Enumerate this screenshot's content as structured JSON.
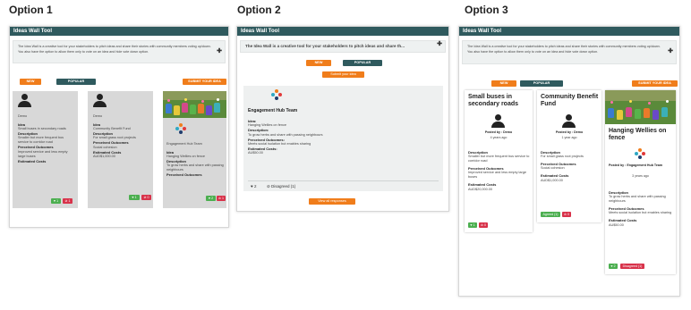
{
  "options": [
    "Option 1",
    "Option 2",
    "Option 3"
  ],
  "header_title": "Ideas Wall Tool",
  "description": "The Idea Wall is a creative tool for your stakeholders to pitch ideas and share their stories with community members voting up/down. You also have the option to allow them only to vote on an idea and hide vote down option.",
  "opt2_description": "The Idea Wall is a creative tool for your stakeholders to pitch ideas and share th...",
  "buttons": {
    "new": "NEW",
    "popular": "POPULAR",
    "submit_upper": "SUBMIT YOUR IDEA",
    "submit": "Submit your idea",
    "view_all": "View all responses"
  },
  "labels": {
    "idea": "Idea",
    "description": "Description",
    "perceived": "Perceived Outcomes",
    "estimated": "Estimated Costs"
  },
  "opt1_cards": [
    {
      "author": "Demo",
      "idea": "Small buses in secondary roads",
      "description": "Smaller but more frequent bus service to corridor road",
      "perceived": "Improved service and less empty large buses",
      "likes": "1",
      "dislikes": "1"
    },
    {
      "author": "Demo",
      "idea": "Community Benefit Fund",
      "description": "For small grass root projects",
      "perceived": "Social cohesion",
      "estimated": "AUD$1,000.00",
      "likes": "1",
      "dislikes": "0"
    },
    {
      "author": "Engagement Hub Team",
      "idea": "Hanging Wellies on fence",
      "description": "To grow herbs and share with passing neighbours",
      "perceived": "",
      "likes": "2",
      "dislikes": "1"
    }
  ],
  "opt2_card": {
    "author": "Engagement Hub Team",
    "idea_label": "Idea:",
    "idea": "Hanging Wellies on fence",
    "description_label": "Description:",
    "description": "To grow herbs and share with passing neighbours",
    "perceived_label": "Perceived Outcomes:",
    "perceived": "Meets social isolation but enables sharing",
    "estimated_label": "Estimated Costs:",
    "estimated": "AU$50.00",
    "likes": "2",
    "disagreed": "Disagreed (1)"
  },
  "opt3_cards": [
    {
      "title": "Small buses in secondary roads",
      "posted_by": "Posted by : Demo",
      "age": "4 years ago",
      "description": "Smaller but more frequent bus service to corridor road",
      "perceived": "Improved service and less empty large buses",
      "estimated": "AUD$20,000.00",
      "likes": "1",
      "dislikes": "0"
    },
    {
      "title": "Community Benefit Fund",
      "posted_by": "Posted by : Demo",
      "age": "1 year ago",
      "description": "For small grass root projects",
      "perceived": "Social cohesion",
      "estimated": "AUD$1,000.00",
      "agreed": "Agreed (1)",
      "dislikes": "0"
    },
    {
      "title": "Hanging Wellies on fence",
      "posted_by": "Posted by : Engagement Hub Team",
      "age": "3 years ago",
      "description": "To grow herbs and share with passing neighbours",
      "perceived": "Meets social isolation but enables sharing",
      "estimated": "AU$50.00",
      "likes": "2",
      "disagreed": "Disagreed (1)"
    }
  ]
}
